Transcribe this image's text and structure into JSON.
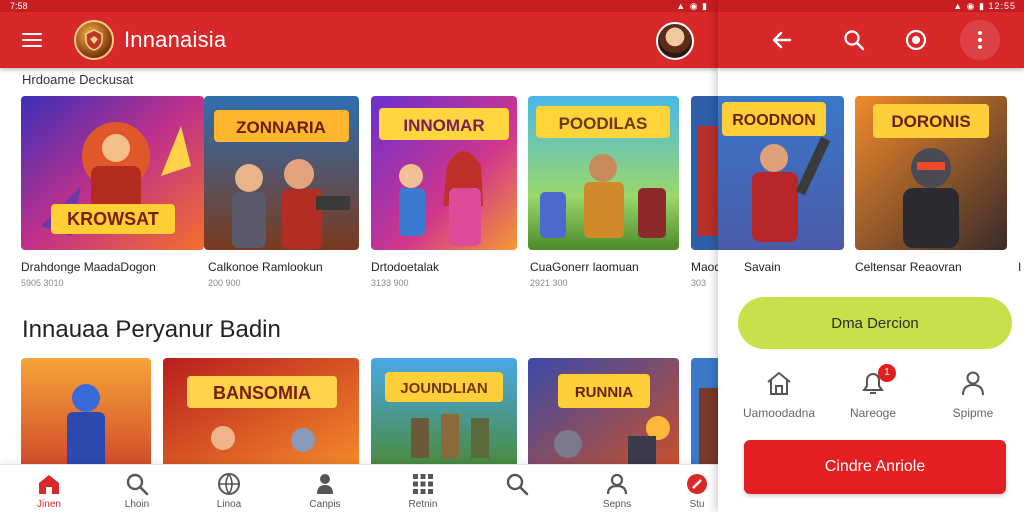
{
  "status": {
    "time_left": "7:58",
    "time_right": "12:55"
  },
  "app": {
    "title": "Innanaisia"
  },
  "sections": {
    "featured_title": "Hrdoame Deckusat",
    "popular_title": "Innauaa Peryanur Badin"
  },
  "featured": [
    {
      "name": "Drahdonge MaadaDogon",
      "meta": "5905 3010",
      "art": "KROWSAT"
    },
    {
      "name": "Calkonoe Ramlookun",
      "meta": "200 900",
      "art": "ZONNARIA"
    },
    {
      "name": "Drtodoetalak",
      "meta": "3133 900",
      "art": "INNOMAR"
    },
    {
      "name": "CuaGonerr laomuan",
      "meta": "2921 300",
      "art": "POODILAS"
    },
    {
      "name": "Maod",
      "meta": "303",
      "art": ""
    }
  ],
  "popular": [
    {
      "art": ""
    },
    {
      "art": "BANSOMIA"
    },
    {
      "art": "JOUNDLIAN"
    },
    {
      "art": "RUNNIA"
    },
    {
      "art": ""
    }
  ],
  "bottom_nav": [
    {
      "label": "Jinen",
      "icon": "home-icon",
      "active": true
    },
    {
      "label": "Lhoin",
      "icon": "search-icon",
      "active": false
    },
    {
      "label": "Linoa",
      "icon": "globe-icon",
      "active": false
    },
    {
      "label": "Canpis",
      "icon": "person-icon",
      "active": false
    },
    {
      "label": "Retnin",
      "icon": "grid-icon",
      "active": false
    },
    {
      "label": "",
      "icon": "search-icon",
      "active": false
    },
    {
      "label": "Sepns",
      "icon": "profile-icon",
      "active": false
    },
    {
      "label": "Stu",
      "icon": "tools-icon",
      "active": false
    }
  ],
  "panel": {
    "cards": [
      {
        "name": "Savain",
        "art": "ROODNON"
      },
      {
        "name": "Celtensar Reaovran",
        "art": "DORONIS"
      }
    ],
    "pill_label": "Dma Dercion",
    "actions": [
      {
        "label": "Uamoodadna",
        "icon": "home-icon"
      },
      {
        "label": "Nareoge",
        "icon": "notification-icon",
        "badge": "1"
      },
      {
        "label": "Spipme",
        "icon": "profile-icon"
      }
    ],
    "primary_button": "Cindre Anriole",
    "edge_char": "I"
  },
  "colors": {
    "brand_red": "#d8282a",
    "accent_lime": "#c6e14a",
    "cta_red": "#e41f22"
  }
}
